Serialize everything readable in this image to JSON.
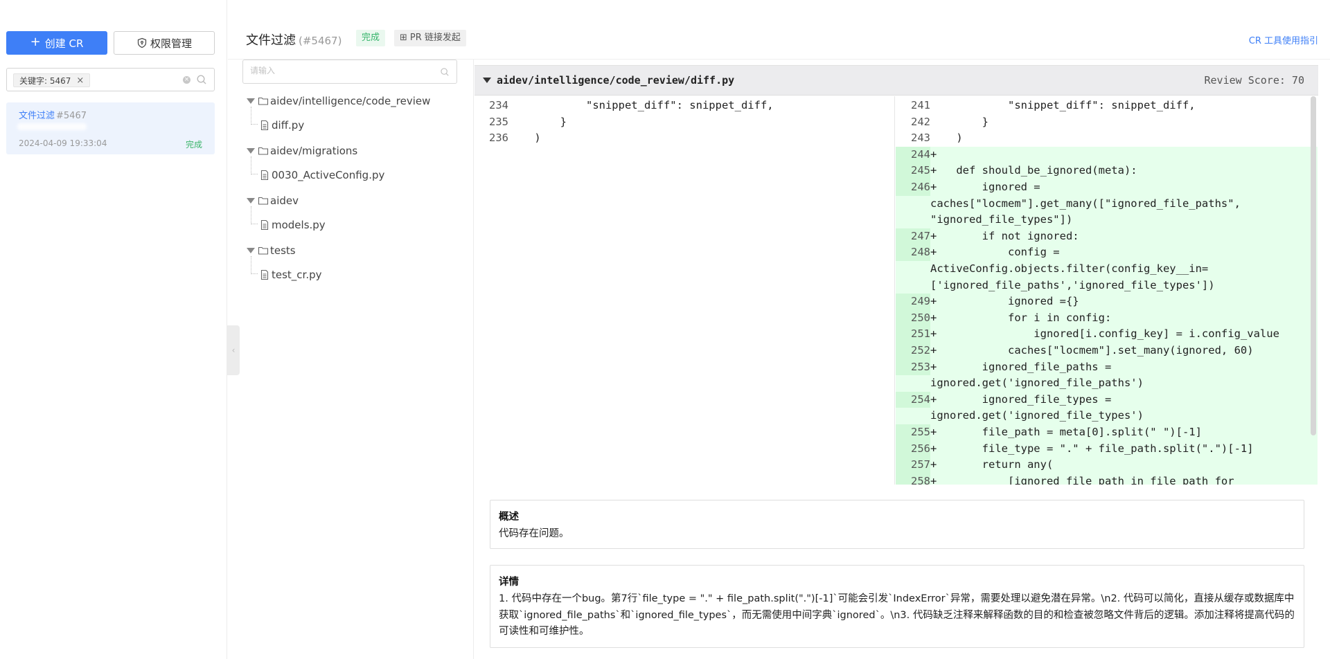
{
  "sidebar": {
    "create_button": "创建 CR",
    "create_icon": "plus-icon",
    "permission_button": "权限管理",
    "permission_icon": "shield-icon",
    "filter_tag": "关键字: 5467",
    "cr_list": [
      {
        "title": "文件过滤",
        "id": "#5467",
        "date": "2024-04-09 19:33:04",
        "status": "完成"
      }
    ]
  },
  "header": {
    "title": "文件过滤",
    "id": "(#5467)",
    "status": "完成",
    "pr_badge": "PR 链接发起",
    "guide_link": "CR 工具使用指引",
    "colors": {
      "accent": "#3e7ff7",
      "success": "#35b56a"
    }
  },
  "tree": {
    "search_placeholder": "请输入",
    "folders": [
      {
        "name": "aidev/intelligence/code_review",
        "files": [
          "diff.py"
        ]
      },
      {
        "name": "aidev/migrations",
        "files": [
          "0030_ActiveConfig.py"
        ]
      },
      {
        "name": "aidev",
        "files": [
          "models.py"
        ]
      },
      {
        "name": "tests",
        "files": [
          "test_cr.py"
        ]
      }
    ]
  },
  "diff": {
    "filename": "aidev/intelligence/code_review/diff.py",
    "review_score": "Review Score: 70",
    "left_lines": [
      {
        "n": "234",
        "t": "            \"snippet_diff\": snippet_diff,"
      },
      {
        "n": "235",
        "t": "        }"
      },
      {
        "n": "236",
        "t": "    )"
      }
    ],
    "right_lines": [
      {
        "n": "241",
        "t": "            \"snippet_diff\": snippet_diff,",
        "add": false
      },
      {
        "n": "242",
        "t": "        }",
        "add": false
      },
      {
        "n": "243",
        "t": "    )",
        "add": false
      },
      {
        "n": "244",
        "t": "+",
        "add": true
      },
      {
        "n": "245",
        "t": "+   def should_be_ignored(meta):",
        "add": true
      },
      {
        "n": "246",
        "t": "+       ignored =",
        "add": true
      },
      {
        "n": "",
        "t": "caches[\"locmem\"].get_many([\"ignored_file_paths\",",
        "add": true
      },
      {
        "n": "",
        "t": "\"ignored_file_types\"])",
        "add": true
      },
      {
        "n": "247",
        "t": "+       if not ignored:",
        "add": true
      },
      {
        "n": "248",
        "t": "+           config =",
        "add": true
      },
      {
        "n": "",
        "t": "ActiveConfig.objects.filter(config_key__in=",
        "add": true
      },
      {
        "n": "",
        "t": "['ignored_file_paths','ignored_file_types'])",
        "add": true
      },
      {
        "n": "249",
        "t": "+           ignored ={}",
        "add": true
      },
      {
        "n": "250",
        "t": "+           for i in config:",
        "add": true
      },
      {
        "n": "251",
        "t": "+               ignored[i.config_key] = i.config_value",
        "add": true
      },
      {
        "n": "252",
        "t": "+           caches[\"locmem\"].set_many(ignored, 60)",
        "add": true
      },
      {
        "n": "253",
        "t": "+       ignored_file_paths =",
        "add": true
      },
      {
        "n": "",
        "t": "ignored.get('ignored_file_paths')",
        "add": true
      },
      {
        "n": "254",
        "t": "+       ignored_file_types =",
        "add": true
      },
      {
        "n": "",
        "t": "ignored.get('ignored_file_types')",
        "add": true
      },
      {
        "n": "255",
        "t": "+       file_path = meta[0].split(\" \")[-1]",
        "add": true
      },
      {
        "n": "256",
        "t": "+       file_type = \".\" + file_path.split(\".\")[-1]",
        "add": true
      },
      {
        "n": "257",
        "t": "+       return any(",
        "add": true
      },
      {
        "n": "258",
        "t": "+           [ignored_file_path in file_path for",
        "add": true
      }
    ]
  },
  "review": {
    "summary_title": "概述",
    "summary_text": "代码存在问题。",
    "detail_title": "详情",
    "detail_text": "1. 代码中存在一个bug。第7行`file_type = \".\" + file_path.split(\".\")[-1]`可能会引发`IndexError`异常，需要处理以避免潜在异常。\\n2. 代码可以简化，直接从缓存或数据库中获取`ignored_file_paths`和`ignored_file_types`，而无需使用中间字典`ignored`。\\n3. 代码缺乏注释来解释函数的目的和检查被忽略文件背后的逻辑。添加注释将提高代码的可读性和可维护性。"
  }
}
